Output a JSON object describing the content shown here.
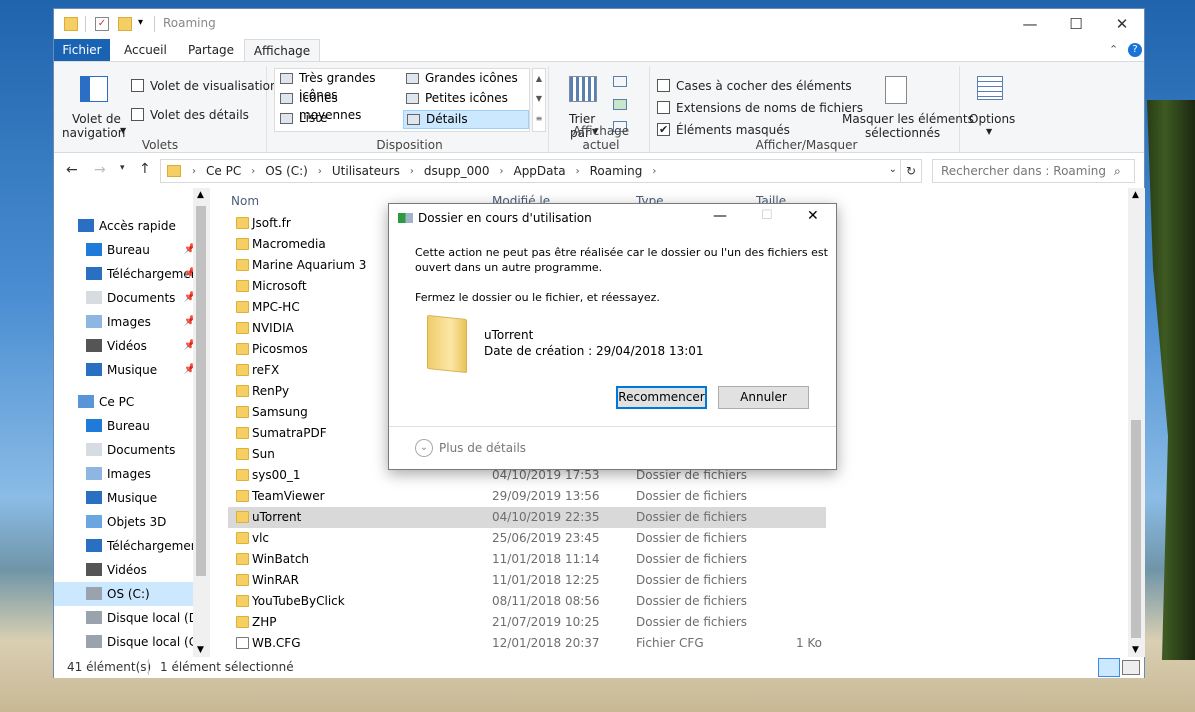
{
  "window": {
    "title": "Roaming",
    "minimize": "—",
    "maximize": "☐",
    "close": "✕"
  },
  "ribbon_tabs": [
    "Fichier",
    "Accueil",
    "Partage",
    "Affichage"
  ],
  "ribbon": {
    "panes": {
      "nav_pane": "Volet de",
      "nav_pane2": "navigation",
      "preview": "Volet de visualisation",
      "details": "Volet des détails",
      "label": "Volets"
    },
    "layout": {
      "items": [
        "Très grandes icônes",
        "Grandes icônes",
        "Icônes moyennes",
        "Petites icônes",
        "Liste",
        "Détails"
      ],
      "selected": "Détails",
      "label": "Disposition"
    },
    "current_view": {
      "sort": "Trier",
      "sort2": "par",
      "label": "Affichage actuel"
    },
    "show_hide": {
      "checkbox1": "Cases à cocher des éléments",
      "checkbox2": "Extensions de noms de fichiers",
      "checkbox3": "Éléments masqués",
      "hide_selected": "Masquer les éléments",
      "hide_selected2": "sélectionnés",
      "label": "Afficher/Masquer"
    },
    "options": "Options"
  },
  "nav": {
    "breadcrumb": [
      "Ce PC",
      "OS (C:)",
      "Utilisateurs",
      "dsupp_000",
      "AppData",
      "Roaming"
    ],
    "search_placeholder": "Rechercher dans : Roaming"
  },
  "sidebar": {
    "items": [
      {
        "label": "Accès rapide",
        "icon": "star-icon",
        "pinned": false
      },
      {
        "label": "Bureau",
        "icon": "desktop-icon",
        "pinned": true
      },
      {
        "label": "Téléchargements",
        "icon": "download-icon",
        "pinned": true
      },
      {
        "label": "Documents",
        "icon": "documents-icon",
        "pinned": true
      },
      {
        "label": "Images",
        "icon": "images-icon",
        "pinned": true
      },
      {
        "label": "Vidéos",
        "icon": "videos-icon",
        "pinned": true
      },
      {
        "label": "Musique",
        "icon": "music-icon",
        "pinned": true
      },
      {
        "label": "Ce PC",
        "icon": "computer-icon",
        "pinned": false
      },
      {
        "label": "Bureau",
        "icon": "desktop-icon",
        "pinned": false
      },
      {
        "label": "Documents",
        "icon": "documents-icon",
        "pinned": false
      },
      {
        "label": "Images",
        "icon": "images-icon",
        "pinned": false
      },
      {
        "label": "Musique",
        "icon": "music-icon",
        "pinned": false
      },
      {
        "label": "Objets 3D",
        "icon": "objects3d-icon",
        "pinned": false
      },
      {
        "label": "Téléchargements",
        "icon": "download-icon",
        "pinned": false
      },
      {
        "label": "Vidéos",
        "icon": "videos-icon",
        "pinned": false
      },
      {
        "label": "OS (C:)",
        "icon": "drive-icon",
        "pinned": false
      },
      {
        "label": "Disque local (D:)",
        "icon": "drive-icon",
        "pinned": false
      },
      {
        "label": "Disque local (G:)",
        "icon": "drive-icon",
        "pinned": false
      }
    ],
    "selected": "OS (C:)"
  },
  "columns": {
    "name": "Nom",
    "modified": "Modifié le",
    "type": "Type",
    "size": "Taille"
  },
  "files": [
    {
      "name": "Jsoft.fr",
      "date": "",
      "type": "",
      "size": ""
    },
    {
      "name": "Macromedia",
      "date": "",
      "type": "",
      "size": ""
    },
    {
      "name": "Marine Aquarium 3",
      "date": "",
      "type": "",
      "size": ""
    },
    {
      "name": "Microsoft",
      "date": "",
      "type": "",
      "size": ""
    },
    {
      "name": "MPC-HC",
      "date": "",
      "type": "",
      "size": ""
    },
    {
      "name": "NVIDIA",
      "date": "",
      "type": "",
      "size": ""
    },
    {
      "name": "Picosmos",
      "date": "",
      "type": "",
      "size": ""
    },
    {
      "name": "reFX",
      "date": "",
      "type": "",
      "size": ""
    },
    {
      "name": "RenPy",
      "date": "",
      "type": "",
      "size": ""
    },
    {
      "name": "Samsung",
      "date": "",
      "type": "",
      "size": ""
    },
    {
      "name": "SumatraPDF",
      "date": "",
      "type": "",
      "size": ""
    },
    {
      "name": "Sun",
      "date": "",
      "type": "",
      "size": ""
    },
    {
      "name": "sys00_1",
      "date": "04/10/2019 17:53",
      "type": "Dossier de fichiers",
      "size": ""
    },
    {
      "name": "TeamViewer",
      "date": "29/09/2019 13:56",
      "type": "Dossier de fichiers",
      "size": ""
    },
    {
      "name": "uTorrent",
      "date": "04/10/2019 22:35",
      "type": "Dossier de fichiers",
      "size": "",
      "selected": true
    },
    {
      "name": "vlc",
      "date": "25/06/2019 23:45",
      "type": "Dossier de fichiers",
      "size": ""
    },
    {
      "name": "WinBatch",
      "date": "11/01/2018 11:14",
      "type": "Dossier de fichiers",
      "size": ""
    },
    {
      "name": "WinRAR",
      "date": "11/01/2018 12:25",
      "type": "Dossier de fichiers",
      "size": ""
    },
    {
      "name": "YouTubeByClick",
      "date": "08/11/2018 08:56",
      "type": "Dossier de fichiers",
      "size": ""
    },
    {
      "name": "ZHP",
      "date": "21/07/2019 10:25",
      "type": "Dossier de fichiers",
      "size": ""
    },
    {
      "name": "WB.CFG",
      "date": "12/01/2018 20:37",
      "type": "Fichier CFG",
      "size": "1 Ko",
      "doc": true
    }
  ],
  "status": {
    "count": "41 élément(s)",
    "selection": "1 élément sélectionné"
  },
  "dialog": {
    "title": "Dossier en cours d'utilisation",
    "message1": "Cette action ne peut pas être réalisée car le dossier ou l'un des fichiers est",
    "message2": "ouvert dans un autre programme.",
    "message3": "Fermez le dossier ou le fichier, et réessayez.",
    "item_name": "uTorrent",
    "item_date": "Date de création : 29/04/2018 13:01",
    "retry": "Recommencer",
    "cancel": "Annuler",
    "more": "Plus de détails"
  }
}
